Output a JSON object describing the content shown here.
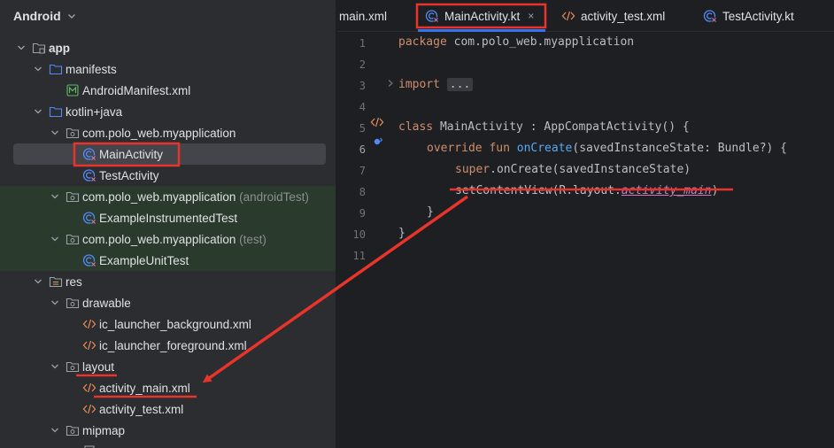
{
  "project_panel": {
    "title": "Android",
    "tree": [
      {
        "label": "app"
      },
      {
        "label": "manifests"
      },
      {
        "label": "AndroidManifest.xml"
      },
      {
        "label": "kotlin+java"
      },
      {
        "label": "com.polo_web.myapplication"
      },
      {
        "label": "MainActivity"
      },
      {
        "label": "TestActivity"
      },
      {
        "label": "com.polo_web.myapplication",
        "suffix": "(androidTest)"
      },
      {
        "label": "ExampleInstrumentedTest"
      },
      {
        "label": "com.polo_web.myapplication",
        "suffix": "(test)"
      },
      {
        "label": "ExampleUnitTest"
      },
      {
        "label": "res"
      },
      {
        "label": "drawable"
      },
      {
        "label": "ic_launcher_background.xml"
      },
      {
        "label": "ic_launcher_foreground.xml"
      },
      {
        "label": "layout"
      },
      {
        "label": "activity_main.xml"
      },
      {
        "label": "activity_test.xml"
      },
      {
        "label": "mipmap"
      }
    ]
  },
  "editor": {
    "tabs": [
      {
        "label": "main.xml"
      },
      {
        "label": "MainActivity.kt",
        "close": "×"
      },
      {
        "label": "activity_test.xml"
      },
      {
        "label": "TestActivity.kt"
      }
    ],
    "line_numbers": [
      "1",
      "2",
      "3",
      "4",
      "5",
      "6",
      "7",
      "8",
      "9",
      "10",
      "11"
    ],
    "code": {
      "l1_kw": "package",
      "l1_rest": " com.polo_web.myapplication",
      "l3_kw": "import",
      "l3_fold": "...",
      "l6_kw": "class",
      "l6_rest": " MainActivity : AppCompatActivity() {",
      "l7_kw": "override fun",
      "l7_fn": "onCreate",
      "l7_rest": "(savedInstanceState: Bundle?) {",
      "l8_kw": "super",
      "l8_rest": ".onCreate(savedInstanceState)",
      "l9_a": "setContentView(R.layout.",
      "l9_prop": "activity_main",
      "l9_b": ")",
      "l10": "}",
      "l11": "}"
    }
  },
  "colors": {
    "annotation_red": "#e8342a",
    "panel_bg": "#2b2d30",
    "editor_bg": "#1e1f22",
    "selection": "#43454a",
    "keyword": "#cf8e6d",
    "function": "#56a8f5",
    "property": "#c77dbb"
  }
}
